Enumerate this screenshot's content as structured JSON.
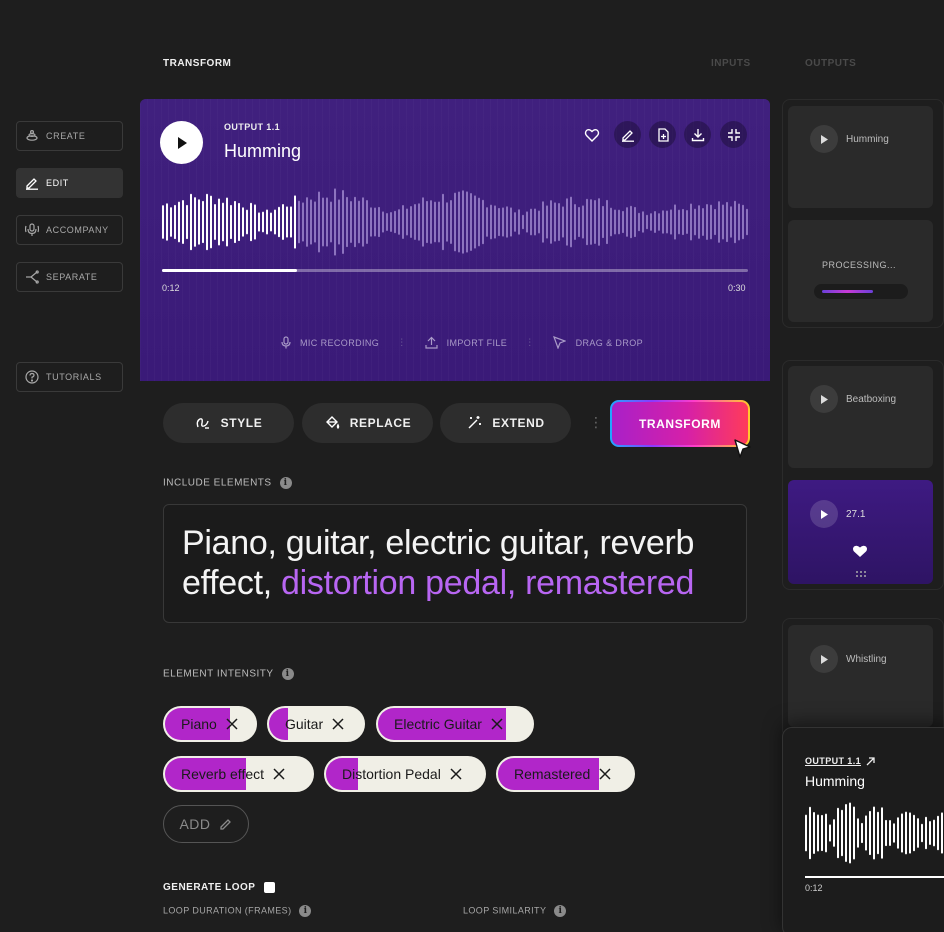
{
  "header": {
    "title": "TRANSFORM",
    "tabs": [
      "INPUTS",
      "OUTPUTS"
    ]
  },
  "sidebar": {
    "items": [
      {
        "label": "CREATE",
        "icon": "stack-icon"
      },
      {
        "label": "EDIT",
        "icon": "pencil-icon"
      },
      {
        "label": "ACCOMPANY",
        "icon": "microphone-icon"
      },
      {
        "label": "SEPARATE",
        "icon": "split-icon"
      },
      {
        "label": "TUTORIALS",
        "icon": "help-circle-icon"
      }
    ]
  },
  "player": {
    "output_label": "OUTPUT 1.1",
    "title": "Humming",
    "current_time": "0:12",
    "total_time": "0:30",
    "progress": 0.23,
    "input_options": [
      "MIC RECORDING",
      "IMPORT FILE",
      "DRAG & DROP"
    ]
  },
  "modes": {
    "style": "STYLE",
    "replace": "REPLACE",
    "extend": "EXTEND",
    "transform": "TRANSFORM"
  },
  "include": {
    "label": "INCLUDE ELEMENTS",
    "text_plain": "Piano, guitar, electric guitar, reverb effect, ",
    "text_accent": "distortion pedal, remastered"
  },
  "intensity": {
    "label": "ELEMENT INTENSITY",
    "chips": [
      {
        "label": "Piano",
        "level": 0.72
      },
      {
        "label": "Guitar",
        "level": 0.2
      },
      {
        "label": "Electric Guitar",
        "level": 0.83
      },
      {
        "label": "Reverb effect",
        "level": 0.55
      },
      {
        "label": "Distortion Pedal",
        "level": 0.2
      },
      {
        "label": "Remastered",
        "level": 0.75
      }
    ],
    "add_label": "ADD"
  },
  "loop": {
    "label": "GENERATE LOOP",
    "duration_label": "LOOP DURATION (FRAMES)",
    "similarity_label": "LOOP SIMILARITY"
  },
  "outputs": {
    "cards": [
      {
        "label": "Humming"
      },
      {
        "label": "PROCESSING...",
        "progress": 0.65
      },
      {
        "label": "Beatboxing"
      },
      {
        "label": "27.1"
      },
      {
        "label": "Whistling"
      }
    ],
    "popup": {
      "output_label": "OUTPUT 1.1",
      "title": "Humming",
      "time": "0:12"
    }
  },
  "colors": {
    "accent": "#b126c9",
    "hero": "#3f1c7e",
    "accent_text": "#b866f2"
  }
}
